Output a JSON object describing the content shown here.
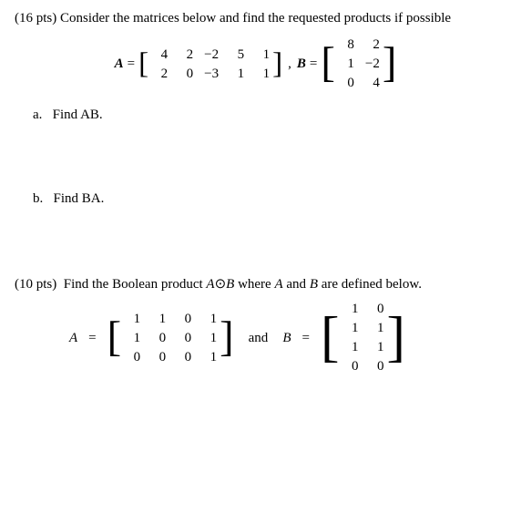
{
  "problem1": {
    "header": "(16 pts)  Consider the matrices below and find the requested products if possible",
    "matrixA": {
      "label": "A",
      "rows": [
        [
          "4",
          "2",
          "−2",
          "5",
          "1"
        ],
        [
          "2",
          "0",
          "−3",
          "1",
          "1"
        ]
      ]
    },
    "matrixB": {
      "label": "B",
      "rows": [
        [
          "8",
          "2"
        ],
        [
          "1",
          "−2"
        ],
        [
          "0",
          "4"
        ]
      ]
    },
    "parts": [
      {
        "label": "a.",
        "text": "Find AB."
      },
      {
        "label": "b.",
        "text": "Find BA."
      }
    ]
  },
  "problem2": {
    "header": "(10 pts)  Find the Boolean product",
    "product_label": "A⊙B",
    "rest": "where",
    "A_label": "A",
    "B_label": "B",
    "rest2": "are defined below.",
    "matrixA": {
      "label": "A",
      "rows": [
        [
          "1",
          "1",
          "0",
          "1"
        ],
        [
          "1",
          "0",
          "0",
          "1"
        ],
        [
          "0",
          "0",
          "0",
          "1"
        ]
      ]
    },
    "and_text": "and",
    "matrixB": {
      "label": "B",
      "rows": [
        [
          "1",
          "0"
        ],
        [
          "1",
          "1"
        ],
        [
          "1",
          "1"
        ],
        [
          "0",
          "0"
        ]
      ]
    }
  }
}
